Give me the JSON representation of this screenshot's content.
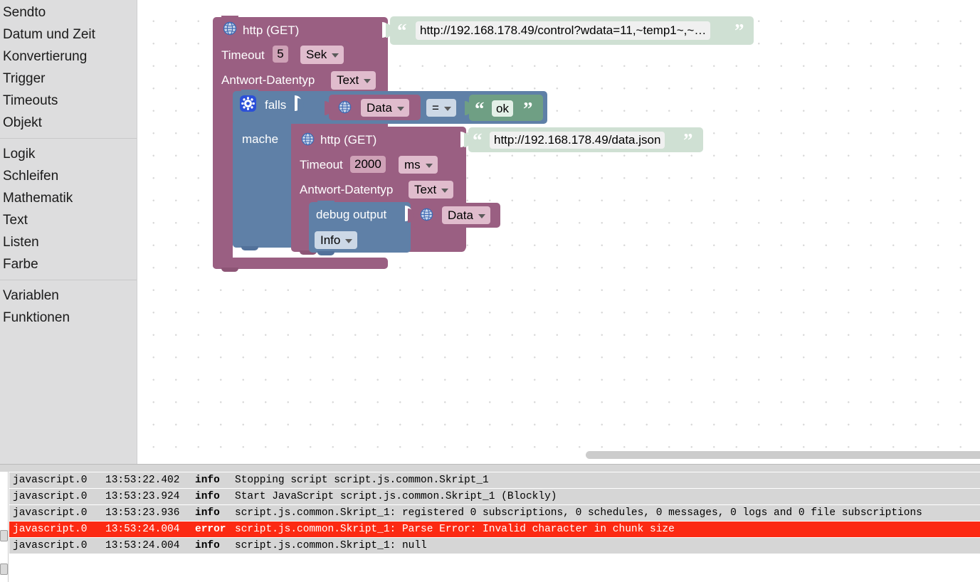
{
  "toolbox": {
    "groups": [
      {
        "items": [
          {
            "label": "Sendto",
            "name": "toolbox-item-sendto"
          },
          {
            "label": "Datum und Zeit",
            "name": "toolbox-item-datum-und-zeit"
          },
          {
            "label": "Konvertierung",
            "name": "toolbox-item-konvertierung"
          },
          {
            "label": "Trigger",
            "name": "toolbox-item-trigger"
          },
          {
            "label": "Timeouts",
            "name": "toolbox-item-timeouts"
          },
          {
            "label": "Objekt",
            "name": "toolbox-item-objekt"
          }
        ]
      },
      {
        "items": [
          {
            "label": "Logik",
            "name": "toolbox-item-logik"
          },
          {
            "label": "Schleifen",
            "name": "toolbox-item-schleifen"
          },
          {
            "label": "Mathematik",
            "name": "toolbox-item-mathematik"
          },
          {
            "label": "Text",
            "name": "toolbox-item-text"
          },
          {
            "label": "Listen",
            "name": "toolbox-item-listen"
          },
          {
            "label": "Farbe",
            "name": "toolbox-item-farbe"
          }
        ]
      },
      {
        "items": [
          {
            "label": "Variablen",
            "name": "toolbox-item-variablen"
          },
          {
            "label": "Funktionen",
            "name": "toolbox-item-funktionen"
          }
        ]
      }
    ]
  },
  "colors": {
    "http_block": "#9a5f82",
    "control_block": "#5f80a7",
    "text_block": "#6f9f84",
    "error_row": "#fc2a13",
    "toolbox_bg": "#ddddde"
  },
  "workspace": {
    "outer_http": {
      "title": "http (GET)",
      "timeout_label": "Timeout",
      "timeout_value": "5",
      "timeout_unit": "Sek",
      "response_type_label": "Antwort-Datentyp",
      "response_type_value": "Text",
      "url": "http://192.168.178.49/control?wdata=11,~temp1~,~…"
    },
    "if_block": {
      "if_label": "falls",
      "do_label": "mache",
      "condition_left": "Data",
      "operator": "=",
      "condition_right": "ok"
    },
    "inner_http": {
      "title": "http (GET)",
      "timeout_label": "Timeout",
      "timeout_value": "2000",
      "timeout_unit": "ms",
      "response_type_label": "Antwort-Datentyp",
      "response_type_value": "Text",
      "url": "http://192.168.178.49/data.json"
    },
    "debug_block": {
      "label": "debug output",
      "severity": "Info",
      "value": "Data"
    }
  },
  "log": {
    "columns": [
      "source",
      "time",
      "severity",
      "message"
    ],
    "rows": [
      {
        "source": "javascript.0",
        "time": "13:53:22.402",
        "severity": "info",
        "message": "Stopping script script.js.common.Skript_1",
        "level": "info"
      },
      {
        "source": "javascript.0",
        "time": "13:53:23.924",
        "severity": "info",
        "message": "Start JavaScript script.js.common.Skript_1 (Blockly)",
        "level": "info"
      },
      {
        "source": "javascript.0",
        "time": "13:53:23.936",
        "severity": "info",
        "message": "script.js.common.Skript_1: registered 0 subscriptions, 0 schedules, 0 messages, 0 logs and 0 file subscriptions",
        "level": "info"
      },
      {
        "source": "javascript.0",
        "time": "13:53:24.004",
        "severity": "error",
        "message": "script.js.common.Skript_1: Parse Error: Invalid character in chunk size",
        "level": "error"
      },
      {
        "source": "javascript.0",
        "time": "13:53:24.004",
        "severity": "info",
        "message": "script.js.common.Skript_1: null",
        "level": "info"
      }
    ]
  }
}
